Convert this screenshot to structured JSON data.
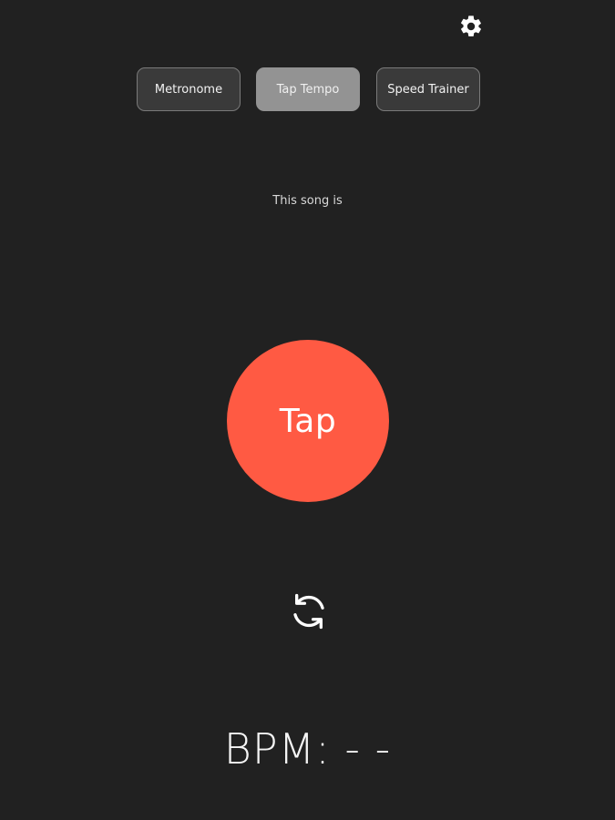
{
  "header": {
    "settings_icon": "gear-icon"
  },
  "tabs": [
    {
      "label": "Metronome",
      "active": false
    },
    {
      "label": "Tap Tempo",
      "active": true
    },
    {
      "label": "Speed Trainer",
      "active": false
    }
  ],
  "main": {
    "song_label": "This song is",
    "tap_label": "Tap",
    "reset_icon": "refresh-icon",
    "bpm_text": "BPM: - -"
  },
  "colors": {
    "background": "#212121",
    "tap_button": "#ff5a43",
    "active_tab": "#939393"
  }
}
